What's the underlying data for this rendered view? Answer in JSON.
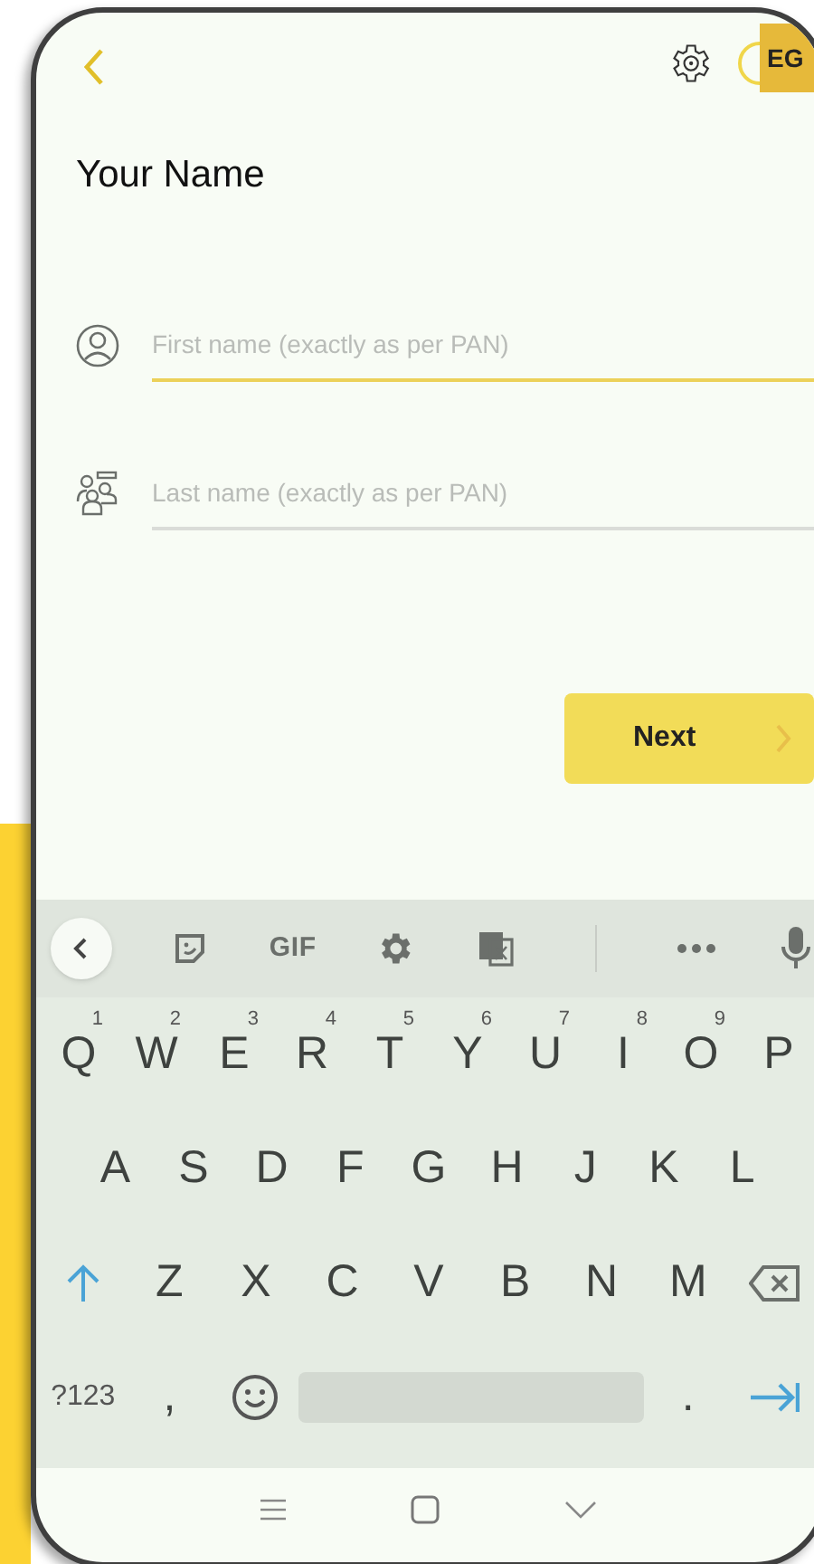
{
  "header": {
    "badge": "EG"
  },
  "title": "Your Name",
  "fields": [
    {
      "kind": "person",
      "placeholder": "First name (exactly as per PAN)",
      "focused": true
    },
    {
      "kind": "group",
      "placeholder": "Last name (exactly as per PAN)",
      "focused": false
    }
  ],
  "next_button": {
    "label": "Next"
  },
  "keyboard": {
    "toolbar": [
      {
        "kind": "back"
      },
      {
        "kind": "sticker"
      },
      {
        "kind": "text",
        "label": "GIF"
      },
      {
        "kind": "settings"
      },
      {
        "kind": "translate"
      },
      {
        "kind": "divider"
      },
      {
        "kind": "more"
      },
      {
        "kind": "mic"
      }
    ],
    "rows": [
      [
        {
          "label": "Q",
          "hint": "1"
        },
        {
          "label": "W",
          "hint": "2"
        },
        {
          "label": "E",
          "hint": "3"
        },
        {
          "label": "R",
          "hint": "4"
        },
        {
          "label": "T",
          "hint": "5"
        },
        {
          "label": "Y",
          "hint": "6"
        },
        {
          "label": "U",
          "hint": "7"
        },
        {
          "label": "I",
          "hint": "8"
        },
        {
          "label": "O",
          "hint": "9"
        },
        {
          "label": "P"
        }
      ],
      [
        {
          "label": "A"
        },
        {
          "label": "S"
        },
        {
          "label": "D"
        },
        {
          "label": "F"
        },
        {
          "label": "G"
        },
        {
          "label": "H"
        },
        {
          "label": "J"
        },
        {
          "label": "K"
        },
        {
          "label": "L"
        }
      ],
      [
        {
          "kind": "shift"
        },
        {
          "label": "Z"
        },
        {
          "label": "X"
        },
        {
          "label": "C"
        },
        {
          "label": "V"
        },
        {
          "label": "B"
        },
        {
          "label": "N"
        },
        {
          "label": "M"
        },
        {
          "kind": "backspace"
        }
      ],
      [
        {
          "kind": "symbols",
          "label": "?123"
        },
        {
          "label": ","
        },
        {
          "kind": "emoji"
        },
        {
          "kind": "space"
        },
        {
          "label": "."
        },
        {
          "kind": "enter"
        }
      ]
    ]
  }
}
